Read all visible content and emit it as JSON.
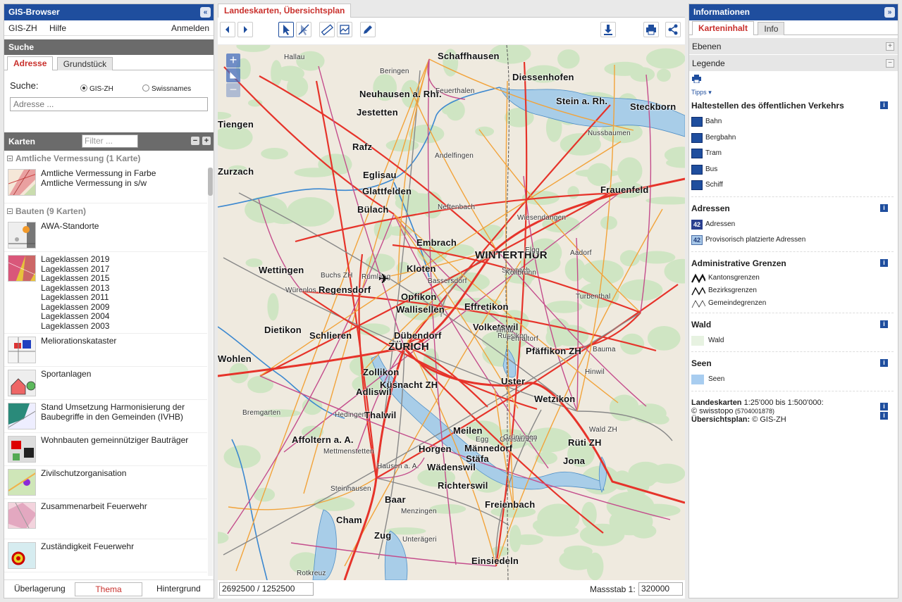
{
  "left": {
    "title": "GIS-Browser",
    "collapse_icon": "«",
    "menu": {
      "home": "GIS-ZH",
      "help": "Hilfe",
      "login": "Anmelden"
    },
    "search": {
      "heading": "Suche",
      "tabs": [
        "Adresse",
        "Grundstück"
      ],
      "label": "Suche:",
      "radio_gis": "GIS-ZH",
      "radio_swiss": "Swissnames",
      "placeholder": "Adresse ..."
    },
    "karten": {
      "heading": "Karten",
      "filter_placeholder": "Filter ...",
      "categories": [
        {
          "title": "Amtliche Vermessung (1 Karte)"
        },
        {
          "title": "Bauten (9 Karten)"
        }
      ],
      "items": [
        {
          "lines": [
            "Amtliche Vermessung in Farbe",
            "Amtliche Vermessung in s/w"
          ]
        },
        {
          "lines": [
            "AWA-Standorte"
          ]
        },
        {
          "lines": [
            "Lageklassen 2019",
            "Lageklassen 2017",
            "Lageklassen 2015",
            "Lageklassen 2013",
            "Lageklassen 2011",
            "Lageklassen 2009",
            "Lageklassen 2004",
            "Lageklassen 2003"
          ]
        },
        {
          "lines": [
            "Meliorationskataster"
          ]
        },
        {
          "lines": [
            "Sportanlagen"
          ]
        },
        {
          "lines": [
            "Stand Umsetzung Harmonisierung der",
            "Baubegriffe in den Gemeinden (IVHB)"
          ]
        },
        {
          "lines": [
            "Wohnbauten gemeinnütziger Bauträger"
          ]
        },
        {
          "lines": [
            "Zivilschutzorganisation"
          ]
        },
        {
          "lines": [
            "Zusammenarbeit Feuerwehr"
          ]
        },
        {
          "lines": [
            "Zuständigkeit Feuerwehr"
          ]
        }
      ]
    },
    "bottom_tabs": {
      "overlay": "Überlagerung",
      "theme": "Thema",
      "background": "Hintergrund"
    }
  },
  "center": {
    "map_tab": "Landeskarten, Übersichtsplan",
    "coords": "2692500 / 1252500",
    "scale_label": "Massstab 1:",
    "scale_value": "320000",
    "places": [
      "Schaffhausen",
      "Diessenhofen",
      "Stein a. Rh.",
      "Steckborn",
      "Frauenfeld",
      "Tiengen",
      "Bülach",
      "WINTERTHUR",
      "Kloten",
      "Opfikon",
      "Wallisellen",
      "Effretikon",
      "Regensdorf",
      "Wettingen",
      "Dietikon",
      "Schlieren",
      "ZÜRICH",
      "Dübendorf",
      "Volketswil",
      "Pfäffikon ZH",
      "Küsnacht ZH",
      "Zollikon",
      "Uster",
      "Wetzikon",
      "Adliswil",
      "Thalwil",
      "Horgen",
      "Meilen",
      "Männedorf",
      "Stäfa",
      "Rüti ZH",
      "Jona",
      "Wädenswil",
      "Richterswil",
      "Freienbach",
      "Affoltern a. A.",
      "Baar",
      "Cham",
      "Zug",
      "Einsiedeln",
      "Rafz",
      "Eglisau",
      "Glattfelden",
      "Embrach",
      "Wohlen",
      "Zurzach",
      "Jestetten",
      "Neuhausen a. Rhf."
    ],
    "small_places": [
      "Hallau",
      "Beringen",
      "Feuerthalen",
      "Andelfingen",
      "Neftenbach",
      "Elgg",
      "Aadorf",
      "Turbenthal",
      "Bauma",
      "Hinwil",
      "Wald ZH",
      "Egg",
      "Gossau ZH",
      "Grüningen",
      "Hedingen",
      "Mettmenstetten",
      "Hausen a. A.",
      "Menzingen",
      "Unterägeri",
      "Steinhausen",
      "Rotkreuz",
      "Bremgarten",
      "Buchs ZH",
      "Würenlos",
      "Rümlang",
      "Bassersdorf",
      "Nussbaumen",
      "Wiesendangen",
      "Seuzach",
      "Kollbrunn",
      "Illnau",
      "Russikon",
      "Fehraltorf"
    ]
  },
  "right": {
    "title": "Informationen",
    "collapse_icon": "»",
    "tabs": [
      "Karteninhalt",
      "Info"
    ],
    "layers": "Ebenen",
    "legend": "Legende",
    "tips": "Tipps",
    "sections": [
      {
        "title": "Haltestellen des öffentlichen Verkehrs",
        "rows": [
          "Bahn",
          "Bergbahn",
          "Tram",
          "Bus",
          "Schiff"
        ]
      },
      {
        "title": "Adressen",
        "rows": [
          "Adressen",
          "Provisorisch platzierte Adressen"
        ],
        "badge": "42"
      },
      {
        "title": "Administrative Grenzen",
        "rows": [
          "Kantonsgrenzen",
          "Bezirksgrenzen",
          "Gemeindegrenzen"
        ]
      },
      {
        "title": "Wald",
        "rows": [
          "Wald"
        ]
      },
      {
        "title": "Seen",
        "rows": [
          "Seen"
        ]
      }
    ],
    "credits": {
      "line1_label": "Landeskarten",
      "line1_text": " 1:25'000 bis 1:500'000:",
      "line2": "© swisstopo",
      "line2_small": " (5704001878)",
      "line3_label": "Übersichtsplan:",
      "line3_text": " © GIS-ZH"
    }
  },
  "colors": {
    "header_blue": "#1f4e9e",
    "active_red": "#c9302c",
    "section_gray": "#6b6b6b"
  }
}
